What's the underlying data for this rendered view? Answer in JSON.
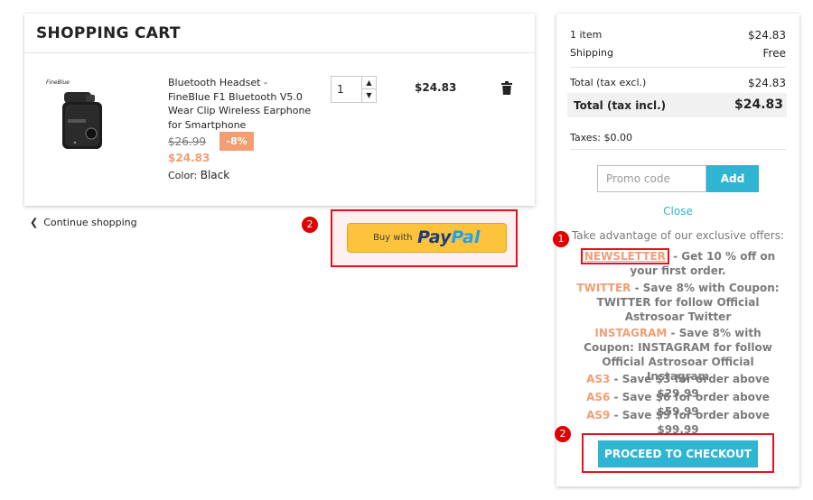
{
  "cart": {
    "title": "SHOPPING CART",
    "item": {
      "image_brand": "FineBlue",
      "name": "Bluetooth Headset - FineBlue F1 Bluetooth V5.0 Wear Clip Wireless Earphone for Smartphone",
      "old_price": "$26.99",
      "discount": "-8%",
      "new_price": "$24.83",
      "color_label": "Color:",
      "color_value": "Black",
      "quantity": "1",
      "line_price": "$24.83"
    },
    "continue_label": "Continue shopping"
  },
  "paypal": {
    "buy_with": "Buy with",
    "brand_part1": "Pay",
    "brand_part2": "Pal"
  },
  "annotations": {
    "badge_1": "1",
    "badge_2a": "2",
    "badge_2b": "2"
  },
  "summary": {
    "items_label": "1 item",
    "items_value": "$24.83",
    "shipping_label": "Shipping",
    "shipping_value": "Free",
    "total_excl_label": "Total (tax excl.)",
    "total_excl_value": "$24.83",
    "total_incl_label": "Total (tax incl.)",
    "total_incl_value": "$24.83",
    "taxes": "Taxes: $0.00",
    "promo_placeholder": "Promo code",
    "add_label": "Add",
    "close_label": "Close",
    "offers_title": "Take advantage of our exclusive offers:",
    "offers": [
      {
        "code": "NEWSLETTER",
        "text": " - Get 10 % off on your first order."
      },
      {
        "code": "TWITTER",
        "text": " - Save 8% with Coupon: TWITTER for follow Official Astrosoar Twitter"
      },
      {
        "code": "INSTAGRAM",
        "text": " - Save 8% with Coupon: INSTAGRAM for follow Official Astrosoar Official Instagram"
      },
      {
        "code": "AS3",
        "text": " - Save $3 for order above $29.99"
      },
      {
        "code": "AS6",
        "text": " - Save $6 for order above $59.99"
      },
      {
        "code": "AS9",
        "text": " - Save $9 for order above $99.99"
      }
    ],
    "checkout_label": "PROCEED TO CHECKOUT"
  },
  "colors": {
    "accent": "#2fb5d2",
    "price_orange": "#f39d72",
    "annotation_red": "#e8101a",
    "paypal_yellow": "#fdc43b"
  }
}
